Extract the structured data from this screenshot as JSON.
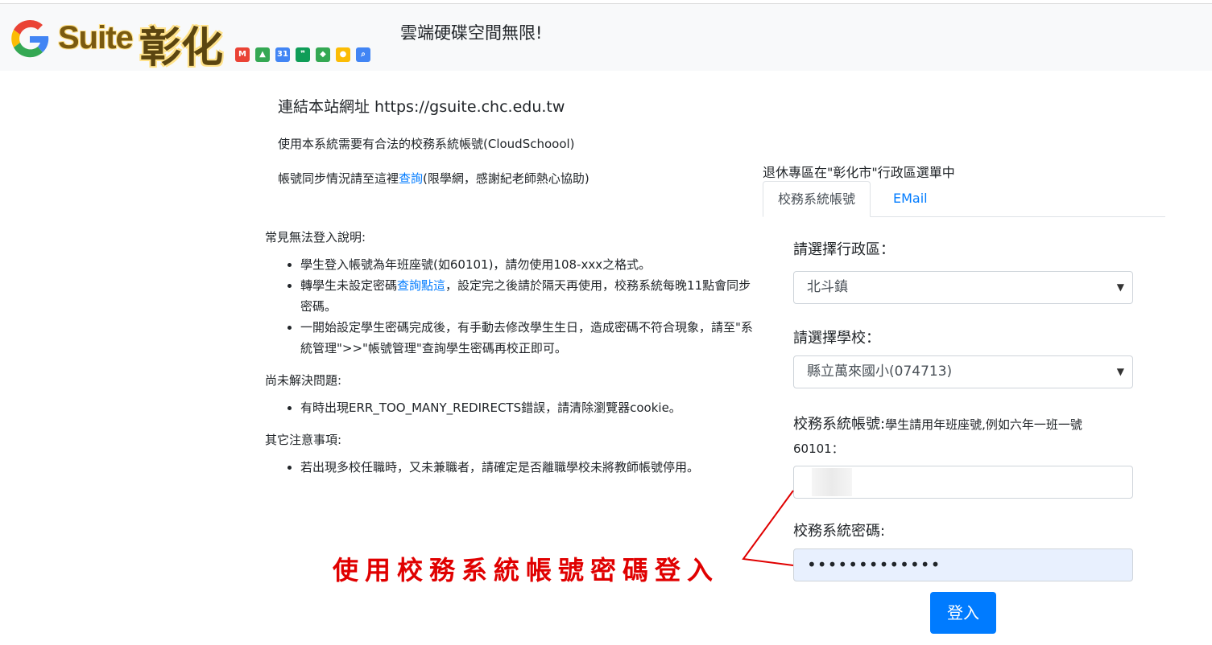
{
  "header": {
    "logo_suite": "Suite",
    "logo_chhua": "彰化",
    "slogan": "雲端硬碟空間無限!",
    "app_icons": [
      {
        "name": "gmail-icon",
        "color": "#ea4335",
        "glyph": "M"
      },
      {
        "name": "drive-icon",
        "color": "#34a853",
        "glyph": "▲"
      },
      {
        "name": "calendar-icon",
        "color": "#4285f4",
        "glyph": "31"
      },
      {
        "name": "hangouts-icon",
        "color": "#0f9d58",
        "glyph": "❞"
      },
      {
        "name": "maps-icon",
        "color": "#34a853",
        "glyph": "◆"
      },
      {
        "name": "chrome-icon",
        "color": "#fbbc05",
        "glyph": "●"
      },
      {
        "name": "search-icon",
        "color": "#4285f4",
        "glyph": "⌕"
      }
    ]
  },
  "intro": {
    "site_url": "連結本站網址 https://gsuite.chc.edu.tw",
    "notice1": "使用本系統需要有合法的校務系統帳號(CloudSchoool)",
    "notice2_before": "帳號同步情況請至這裡",
    "notice2_link": "查詢",
    "notice2_after": "(限學網，感謝紀老師熱心協助)"
  },
  "faq": {
    "common_title": "常見無法登入說明:",
    "common_item1": "學生登入帳號為年班座號(如60101)，請勿使用108-xxx之格式。",
    "common_item2_before": "轉學生未設定密碼",
    "common_item2_link": "查詢點這",
    "common_item2_after": "，設定完之後請於隔天再使用，校務系統每晚11點會同步密碼。",
    "common_item3": "一開始設定學生密碼完成後，有手動去修改學生生日，造成密碼不符合現象，請至\"系統管理\">>\"帳號管理\"查詢學生密碼再校正即可。",
    "unsolved_title": "尚未解決問題:",
    "unsolved_item1": "有時出現ERR_TOO_MANY_REDIRECTS錯誤，請清除瀏覽器cookie。",
    "other_title": "其它注意事項:",
    "other_item1": "若出現多校任職時，又未兼職者，請確定是否離職學校未將教師帳號停用。"
  },
  "login": {
    "retire_note": "退休專區在\"彰化市\"行政區選單中",
    "tab_school_account": "校務系統帳號",
    "tab_email": "EMail",
    "district_label": "請選擇行政區：",
    "district_value": "北斗鎮",
    "school_label": "請選擇學校：",
    "school_value": "縣立萬來國小(074713)",
    "account_label": "校務系統帳號:",
    "account_hint": "學生請用年班座號,例如六年一班一號60101：",
    "password_label": "校務系統密碼:",
    "password_mask": "•••••••••••••",
    "login_button": "登入"
  },
  "annotation": {
    "text": "使用校務系統帳號密碼登入",
    "color": "#e00000"
  }
}
